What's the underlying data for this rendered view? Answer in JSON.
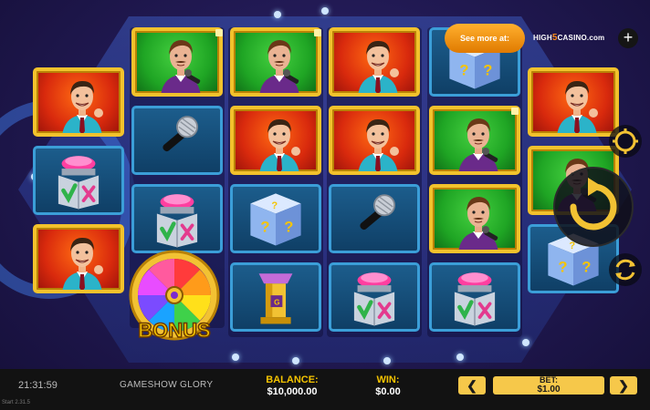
{
  "game": {
    "title": "GAMESHOW GLORY",
    "clock": "21:31:59",
    "build": "Start 2.31.5"
  },
  "balance": {
    "label": "BALANCE:",
    "value": "$10,000.00"
  },
  "win": {
    "label": "WIN:",
    "value": "$0.00"
  },
  "bet": {
    "label": "BET:",
    "value": "$1.00",
    "decrease": "❮",
    "increase": "❯"
  },
  "promo": {
    "label": "See more at:",
    "brand_prefix": "HIGH",
    "brand_mid": "5",
    "brand_suffix": "CASINO.com",
    "add": "+"
  },
  "bonus": {
    "label": "BONUS"
  },
  "icons": [
    "host-symbol",
    "microphone-symbol",
    "mystery-box-symbol",
    "buzzer-symbol",
    "podium-symbol",
    "bonus-wheel-symbol",
    "spin-icon",
    "autoplay-icon",
    "settings-icon"
  ],
  "colors": {
    "gold": "#f6c84a",
    "background": "#221a55",
    "hex": "#3b57b8",
    "red_frame": "#d92a0d",
    "green_frame": "#1fa524"
  }
}
